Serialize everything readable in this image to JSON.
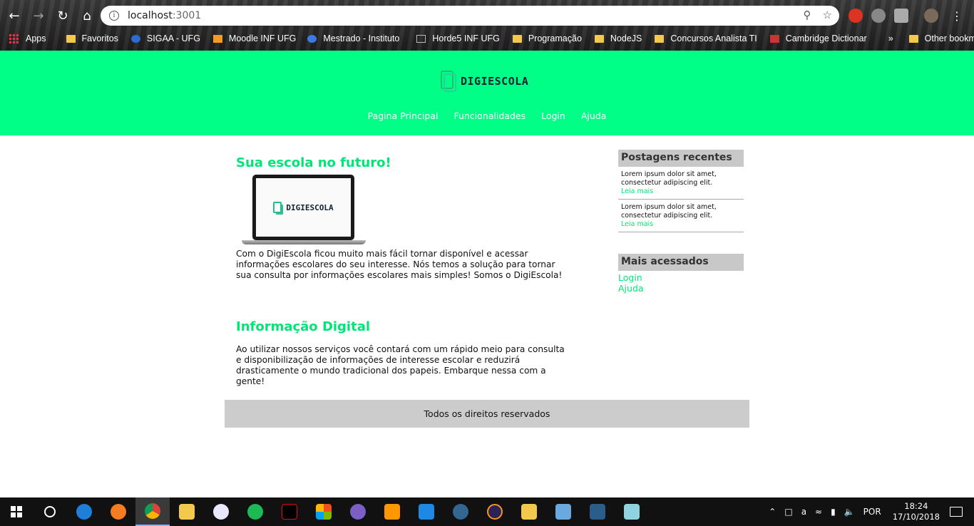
{
  "browser": {
    "url_host": "localhost",
    "url_port": ":3001",
    "bookmarks": [
      "Apps",
      "Favoritos",
      "SIGAA - UFG",
      "Moodle INF UFG",
      "Mestrado - Instituto",
      "Horde5 INF UFG",
      "Programação",
      "NodeJS",
      "Concursos Analista TI",
      "Cambridge Dictionar",
      "»",
      "Other bookmarks"
    ]
  },
  "site": {
    "brand": "DIGIESCOLA",
    "nav": [
      "Pagina Principal",
      "Funcionalidades",
      "Login",
      "Ajuda"
    ],
    "accent_color": "#00ff87",
    "article1": {
      "title": "Sua escola no futuro!",
      "image_text": "DIGIESCOLA",
      "text": "Com o DigiEscola ficou muito mais fácil tornar disponível e acessar informações escolares do seu interesse. Nós temos a solução para tornar sua consulta por informações escolares mais simples! Somos o DigiEscola!"
    },
    "article2": {
      "title": "Informação Digital",
      "text": "Ao utilizar nossos serviços você contará com um rápido meio para consulta e disponibilização de informações de interesse escolar e reduzirá drasticamente o mundo tradicional dos papeis. Embarque nessa com a gente!"
    },
    "sidebar": {
      "recent_title": "Postagens recentes",
      "posts": [
        {
          "text": "Lorem ipsum dolor sit amet, consectetur adipiscing elit.",
          "more": "Leia mais"
        },
        {
          "text": "Lorem ipsum dolor sit amet, consectetur adipiscing elit.",
          "more": "Leia mais"
        }
      ],
      "popular_title": "Mais acessados",
      "popular_links": [
        "Login",
        "Ajuda"
      ]
    },
    "footer": "Todos os direitos reservados"
  },
  "taskbar": {
    "language": "POR",
    "time": "18:24",
    "date": "17/10/2018"
  }
}
